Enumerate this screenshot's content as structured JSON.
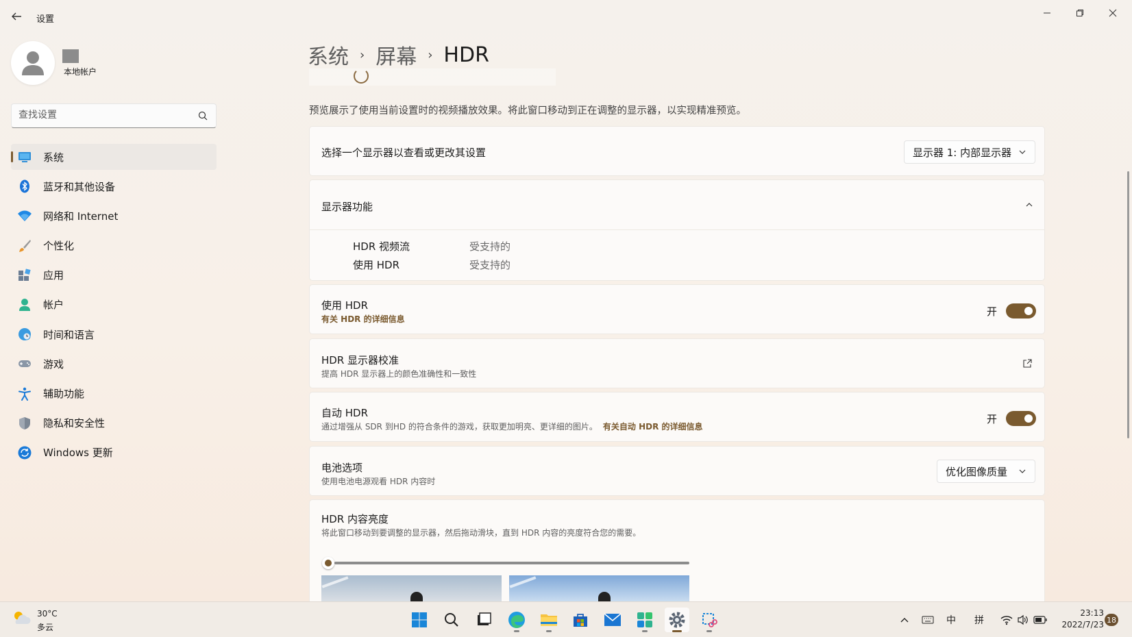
{
  "window": {
    "title": "设置"
  },
  "profile": {
    "name": "本地帐户"
  },
  "search": {
    "placeholder": "查找设置"
  },
  "sidebar": {
    "items": [
      {
        "label": "系统",
        "icon": "system-icon",
        "active": true
      },
      {
        "label": "蓝牙和其他设备",
        "icon": "bluetooth-icon"
      },
      {
        "label": "网络和 Internet",
        "icon": "wifi-icon"
      },
      {
        "label": "个性化",
        "icon": "brush-icon"
      },
      {
        "label": "应用",
        "icon": "apps-icon"
      },
      {
        "label": "帐户",
        "icon": "account-icon"
      },
      {
        "label": "时间和语言",
        "icon": "globe-clock-icon"
      },
      {
        "label": "游戏",
        "icon": "gamepad-icon"
      },
      {
        "label": "辅助功能",
        "icon": "accessibility-icon"
      },
      {
        "label": "隐私和安全性",
        "icon": "shield-icon"
      },
      {
        "label": "Windows 更新",
        "icon": "update-icon"
      }
    ]
  },
  "breadcrumb": {
    "items": [
      "系统",
      "屏幕",
      "HDR"
    ]
  },
  "main": {
    "preview_desc": "预览展示了使用当前设置时的视频播放效果。将此窗口移动到正在调整的显示器，以实现精准预览。",
    "display_select": {
      "label": "选择一个显示器以查看或更改其设置",
      "value": "显示器 1: 内部显示器"
    },
    "capabilities": {
      "title": "显示器功能",
      "rows": [
        {
          "name": "HDR 视频流",
          "value": "受支持的"
        },
        {
          "name": "使用 HDR",
          "value": "受支持的"
        }
      ]
    },
    "use_hdr": {
      "title": "使用 HDR",
      "link": "有关 HDR 的详细信息",
      "state": "开",
      "on": true
    },
    "calibration": {
      "title": "HDR 显示器校准",
      "sub": "提高 HDR 显示器上的颜色准确性和一致性"
    },
    "auto_hdr": {
      "title": "自动 HDR",
      "sub": "通过增强从 SDR 到HD 的符合条件的游戏，获取更加明亮、更详细的图片。",
      "link": "有关自动 HDR 的详细信息",
      "state": "开",
      "on": true
    },
    "battery": {
      "title": "电池选项",
      "sub": "使用电池电源观看 HDR 内容时",
      "value": "优化图像质量"
    },
    "brightness": {
      "title": "HDR 内容亮度",
      "sub": "将此窗口移动到要调整的显示器，然后拖动滑块，直到 HDR 内容的亮度符合您的需要。",
      "level": 0
    }
  },
  "taskbar": {
    "weather": {
      "temp": "30°C",
      "desc": "多云"
    },
    "apps": [
      "windows-start-icon",
      "search-icon",
      "task-view-icon",
      "edge-icon",
      "file-explorer-icon",
      "store-icon",
      "mail-icon",
      "widgets-icon",
      "settings-icon",
      "snipping-tool-icon"
    ],
    "tray": {
      "ime1": "中",
      "ime2": "拼"
    },
    "clock": {
      "time": "23:13",
      "date": "2022/7/23"
    },
    "notifications": "18"
  }
}
